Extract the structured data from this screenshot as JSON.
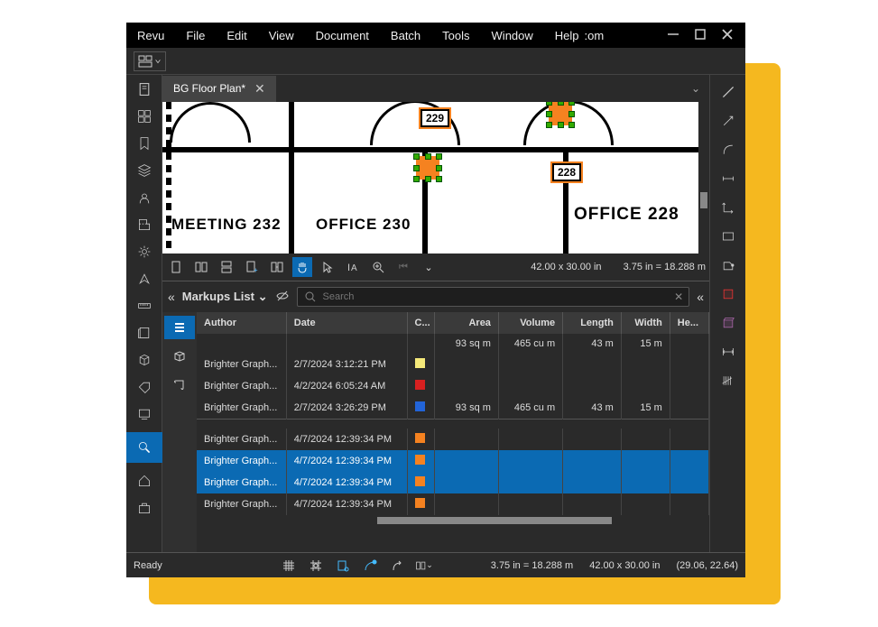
{
  "menubar": {
    "items": [
      "Revu",
      "File",
      "Edit",
      "View",
      "Document",
      "Batch",
      "Tools",
      "Window",
      "Help"
    ],
    "extra": ":om"
  },
  "tab": {
    "title": "BG Floor Plan*"
  },
  "canvas": {
    "rooms": [
      {
        "label": "MEETING  232"
      },
      {
        "label": "OFFICE  230",
        "num": "229"
      },
      {
        "label": "OFFICE  228",
        "num": "228"
      }
    ]
  },
  "canvas_toolbar": {
    "dims": "42.00 x 30.00 in",
    "scale": "3.75 in = 18.288 m"
  },
  "markups": {
    "panel_title": "Markups List",
    "search_placeholder": "Search",
    "columns": [
      "Author",
      "Date",
      "C...",
      "Area",
      "Volume",
      "Length",
      "Width",
      "He..."
    ],
    "summary": {
      "area": "93 sq m",
      "volume": "465 cu m",
      "length": "43 m",
      "width": "15 m"
    },
    "rows": [
      {
        "author": "Brighter Graph...",
        "date": "2/7/2024 3:12:21 PM",
        "color": "#f5e97a",
        "area": "",
        "volume": "",
        "length": "",
        "width": ""
      },
      {
        "author": "Brighter Graph...",
        "date": "4/2/2024 6:05:24 AM",
        "color": "#d82020",
        "area": "",
        "volume": "",
        "length": "",
        "width": ""
      },
      {
        "author": "Brighter Graph...",
        "date": "2/7/2024 3:26:29 PM",
        "color": "#2264d8",
        "area": "93 sq m",
        "volume": "465 cu m",
        "length": "43 m",
        "width": "15 m"
      },
      {
        "gap": true
      },
      {
        "author": "Brighter Graph...",
        "date": "4/7/2024 12:39:34 PM",
        "color": "#f58220",
        "area": "",
        "volume": "",
        "length": "",
        "width": ""
      },
      {
        "author": "Brighter Graph...",
        "date": "4/7/2024 12:39:34 PM",
        "color": "#f58220",
        "sel": true
      },
      {
        "author": "Brighter Graph...",
        "date": "4/7/2024 12:39:34 PM",
        "color": "#f58220",
        "sel": true
      },
      {
        "author": "Brighter Graph...",
        "date": "4/7/2024 12:39:34 PM",
        "color": "#f58220"
      }
    ]
  },
  "status": {
    "ready": "Ready",
    "scale": "3.75 in = 18.288 m",
    "dims": "42.00 x 30.00 in",
    "coords": "(29.06, 22.64)"
  }
}
